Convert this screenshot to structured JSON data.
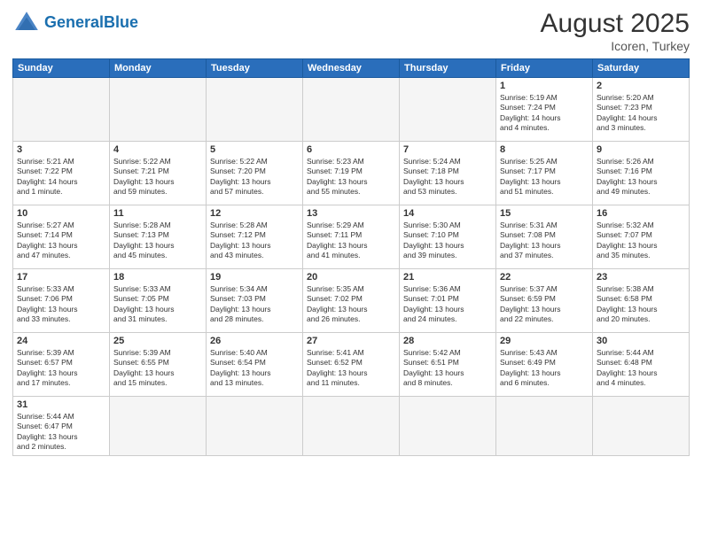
{
  "header": {
    "logo_general": "General",
    "logo_blue": "Blue",
    "month_year": "August 2025",
    "location": "Icoren, Turkey"
  },
  "days_of_week": [
    "Sunday",
    "Monday",
    "Tuesday",
    "Wednesday",
    "Thursday",
    "Friday",
    "Saturday"
  ],
  "weeks": [
    [
      {
        "day": "",
        "info": ""
      },
      {
        "day": "",
        "info": ""
      },
      {
        "day": "",
        "info": ""
      },
      {
        "day": "",
        "info": ""
      },
      {
        "day": "",
        "info": ""
      },
      {
        "day": "1",
        "info": "Sunrise: 5:19 AM\nSunset: 7:24 PM\nDaylight: 14 hours\nand 4 minutes."
      },
      {
        "day": "2",
        "info": "Sunrise: 5:20 AM\nSunset: 7:23 PM\nDaylight: 14 hours\nand 3 minutes."
      }
    ],
    [
      {
        "day": "3",
        "info": "Sunrise: 5:21 AM\nSunset: 7:22 PM\nDaylight: 14 hours\nand 1 minute."
      },
      {
        "day": "4",
        "info": "Sunrise: 5:22 AM\nSunset: 7:21 PM\nDaylight: 13 hours\nand 59 minutes."
      },
      {
        "day": "5",
        "info": "Sunrise: 5:22 AM\nSunset: 7:20 PM\nDaylight: 13 hours\nand 57 minutes."
      },
      {
        "day": "6",
        "info": "Sunrise: 5:23 AM\nSunset: 7:19 PM\nDaylight: 13 hours\nand 55 minutes."
      },
      {
        "day": "7",
        "info": "Sunrise: 5:24 AM\nSunset: 7:18 PM\nDaylight: 13 hours\nand 53 minutes."
      },
      {
        "day": "8",
        "info": "Sunrise: 5:25 AM\nSunset: 7:17 PM\nDaylight: 13 hours\nand 51 minutes."
      },
      {
        "day": "9",
        "info": "Sunrise: 5:26 AM\nSunset: 7:16 PM\nDaylight: 13 hours\nand 49 minutes."
      }
    ],
    [
      {
        "day": "10",
        "info": "Sunrise: 5:27 AM\nSunset: 7:14 PM\nDaylight: 13 hours\nand 47 minutes."
      },
      {
        "day": "11",
        "info": "Sunrise: 5:28 AM\nSunset: 7:13 PM\nDaylight: 13 hours\nand 45 minutes."
      },
      {
        "day": "12",
        "info": "Sunrise: 5:28 AM\nSunset: 7:12 PM\nDaylight: 13 hours\nand 43 minutes."
      },
      {
        "day": "13",
        "info": "Sunrise: 5:29 AM\nSunset: 7:11 PM\nDaylight: 13 hours\nand 41 minutes."
      },
      {
        "day": "14",
        "info": "Sunrise: 5:30 AM\nSunset: 7:10 PM\nDaylight: 13 hours\nand 39 minutes."
      },
      {
        "day": "15",
        "info": "Sunrise: 5:31 AM\nSunset: 7:08 PM\nDaylight: 13 hours\nand 37 minutes."
      },
      {
        "day": "16",
        "info": "Sunrise: 5:32 AM\nSunset: 7:07 PM\nDaylight: 13 hours\nand 35 minutes."
      }
    ],
    [
      {
        "day": "17",
        "info": "Sunrise: 5:33 AM\nSunset: 7:06 PM\nDaylight: 13 hours\nand 33 minutes."
      },
      {
        "day": "18",
        "info": "Sunrise: 5:33 AM\nSunset: 7:05 PM\nDaylight: 13 hours\nand 31 minutes."
      },
      {
        "day": "19",
        "info": "Sunrise: 5:34 AM\nSunset: 7:03 PM\nDaylight: 13 hours\nand 28 minutes."
      },
      {
        "day": "20",
        "info": "Sunrise: 5:35 AM\nSunset: 7:02 PM\nDaylight: 13 hours\nand 26 minutes."
      },
      {
        "day": "21",
        "info": "Sunrise: 5:36 AM\nSunset: 7:01 PM\nDaylight: 13 hours\nand 24 minutes."
      },
      {
        "day": "22",
        "info": "Sunrise: 5:37 AM\nSunset: 6:59 PM\nDaylight: 13 hours\nand 22 minutes."
      },
      {
        "day": "23",
        "info": "Sunrise: 5:38 AM\nSunset: 6:58 PM\nDaylight: 13 hours\nand 20 minutes."
      }
    ],
    [
      {
        "day": "24",
        "info": "Sunrise: 5:39 AM\nSunset: 6:57 PM\nDaylight: 13 hours\nand 17 minutes."
      },
      {
        "day": "25",
        "info": "Sunrise: 5:39 AM\nSunset: 6:55 PM\nDaylight: 13 hours\nand 15 minutes."
      },
      {
        "day": "26",
        "info": "Sunrise: 5:40 AM\nSunset: 6:54 PM\nDaylight: 13 hours\nand 13 minutes."
      },
      {
        "day": "27",
        "info": "Sunrise: 5:41 AM\nSunset: 6:52 PM\nDaylight: 13 hours\nand 11 minutes."
      },
      {
        "day": "28",
        "info": "Sunrise: 5:42 AM\nSunset: 6:51 PM\nDaylight: 13 hours\nand 8 minutes."
      },
      {
        "day": "29",
        "info": "Sunrise: 5:43 AM\nSunset: 6:49 PM\nDaylight: 13 hours\nand 6 minutes."
      },
      {
        "day": "30",
        "info": "Sunrise: 5:44 AM\nSunset: 6:48 PM\nDaylight: 13 hours\nand 4 minutes."
      }
    ],
    [
      {
        "day": "31",
        "info": "Sunrise: 5:44 AM\nSunset: 6:47 PM\nDaylight: 13 hours\nand 2 minutes."
      },
      {
        "day": "",
        "info": ""
      },
      {
        "day": "",
        "info": ""
      },
      {
        "day": "",
        "info": ""
      },
      {
        "day": "",
        "info": ""
      },
      {
        "day": "",
        "info": ""
      },
      {
        "day": "",
        "info": ""
      }
    ]
  ]
}
